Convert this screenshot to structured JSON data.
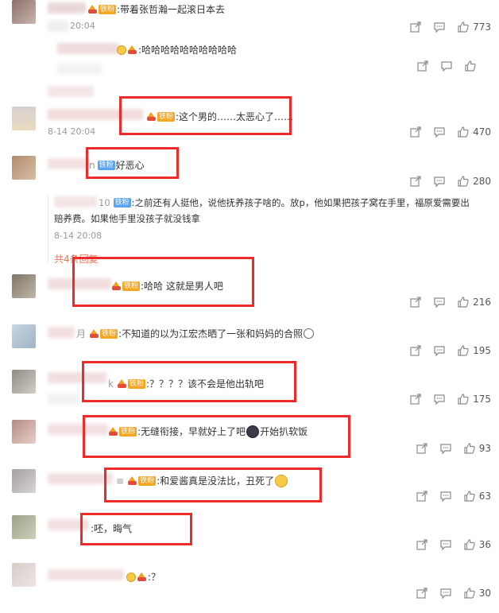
{
  "badges": {
    "gold": "铁粉",
    "blue": "铁粉"
  },
  "comments": [
    {
      "text": ":带着张哲瀚一起滚日本去",
      "time": "20:04",
      "likes": "773"
    },
    {
      "text": ":哈哈哈哈哈哈哈哈哈哈",
      "likes": ""
    },
    {
      "text": ":这个男的……太恶心了……",
      "time": "8-14 20:04",
      "likes": "470"
    },
    {
      "prefix": "n",
      "text": "好恶心",
      "likes": "280"
    },
    {
      "prefix": "10",
      "text": ":之前还有人挺他，说他抚养孩子啥的。放p，他如果把孩子窝在手里，福原爱需要出",
      "text2": "赔养费。如果他手里没孩子就没钱拿",
      "time": "8-14 20:08",
      "more": "共4条回复"
    },
    {
      "text": ":哈哈 这就是男人吧",
      "likes": "216"
    },
    {
      "prefix": "月",
      "text": ":不知道的以为江宏杰晒了一张和妈妈的合照",
      "likes": "195"
    },
    {
      "prefix": "k",
      "text": ":？？？？该不会是他出轨吧",
      "likes": "175"
    },
    {
      "text": ":无缝衔接，早就好上了吧",
      "text_after": "开始扒软饭",
      "likes": "93"
    },
    {
      "text": ":和爱酱真是没法比，丑死了",
      "likes": "63"
    },
    {
      "text": ":呸，晦气",
      "likes": "36"
    },
    {
      "text": ":？",
      "likes": "30"
    }
  ]
}
